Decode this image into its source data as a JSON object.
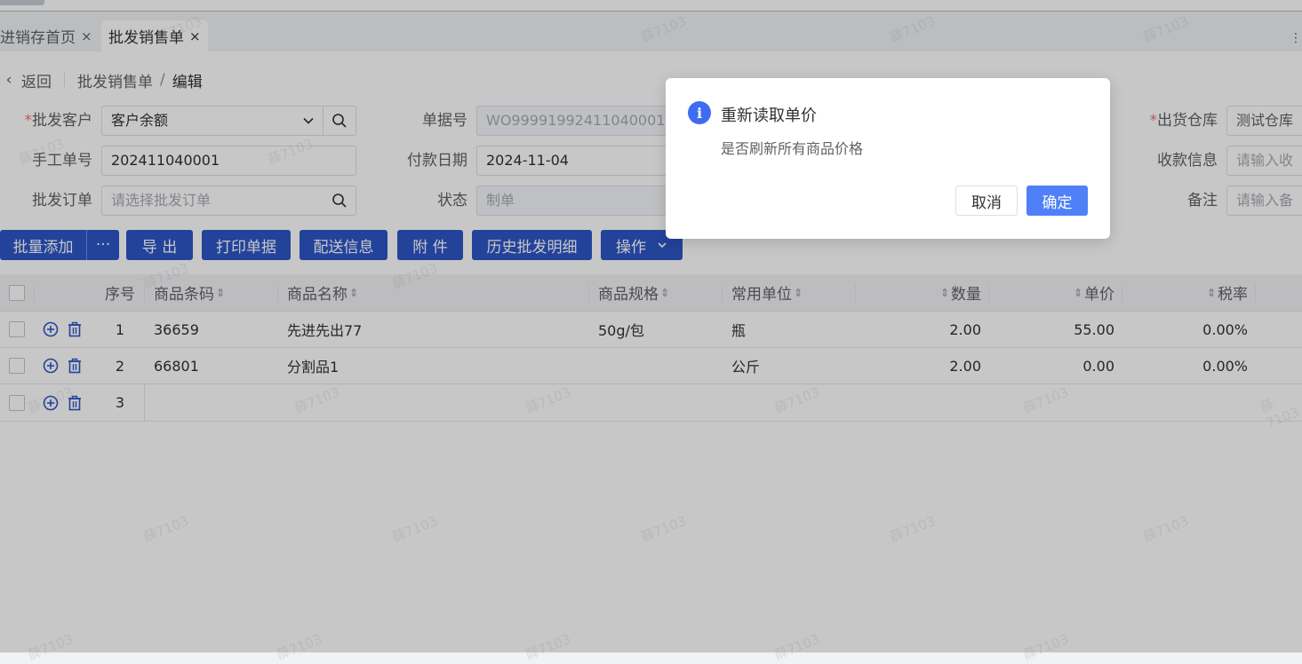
{
  "tabs": [
    {
      "label": "进销存首页",
      "close": "×"
    },
    {
      "label": "批发销售单",
      "close": "×"
    }
  ],
  "breadcrumb": {
    "back": "返回",
    "parent": "批发销售单",
    "separator": "/",
    "current": "编辑"
  },
  "form": {
    "customer": {
      "label": "批发客户",
      "value": "客户余额"
    },
    "doc_no": {
      "label": "单据号",
      "value": "WO99991992411040001"
    },
    "warehouse": {
      "label": "出货仓库",
      "value": "测试仓库"
    },
    "manual_no": {
      "label": "手工单号",
      "value": "202411040001"
    },
    "pay_date": {
      "label": "付款日期",
      "value": "2024-11-04"
    },
    "receipt_info": {
      "label": "收款信息",
      "placeholder": "请输入收"
    },
    "order": {
      "label": "批发订单",
      "placeholder": "请选择批发订单"
    },
    "status": {
      "label": "状态",
      "value": "制单"
    },
    "remark": {
      "label": "备注",
      "placeholder": "请输入备"
    },
    "required_mark": "*"
  },
  "toolbar": {
    "batch_add": "批量添加",
    "more": "···",
    "export": "导 出",
    "print": "打印单据",
    "delivery": "配送信息",
    "attachment": "附 件",
    "history": "历史批发明细",
    "actions": "操作"
  },
  "table": {
    "headers": {
      "index": "序号",
      "barcode": "商品条码",
      "name": "商品名称",
      "spec": "商品规格",
      "unit": "常用单位",
      "qty": "数量",
      "price": "单价",
      "tax": "税率"
    },
    "sort_glyph": "⇕",
    "rows": [
      {
        "index": "1",
        "barcode": "36659",
        "name": "先进先出77",
        "spec": "50g/包",
        "unit": "瓶",
        "qty": "2.00",
        "price": "55.00",
        "tax": "0.00%"
      },
      {
        "index": "2",
        "barcode": "66801",
        "name": "分割品1",
        "spec": "",
        "unit": "公斤",
        "qty": "2.00",
        "price": "0.00",
        "tax": "0.00%"
      },
      {
        "index": "3",
        "barcode": "",
        "name": "",
        "spec": "",
        "unit": "",
        "qty": "",
        "price": "",
        "tax": ""
      }
    ]
  },
  "dialog": {
    "icon": "info-icon",
    "title": "重新读取单价",
    "message": "是否刷新所有商品价格",
    "cancel": "取消",
    "confirm": "确定"
  },
  "watermark": "薛7103",
  "colors": {
    "primary": "#2e56c7",
    "dialog_confirm": "#4f80f7",
    "info": "#3d6cf2",
    "required": "#f56c6c"
  }
}
